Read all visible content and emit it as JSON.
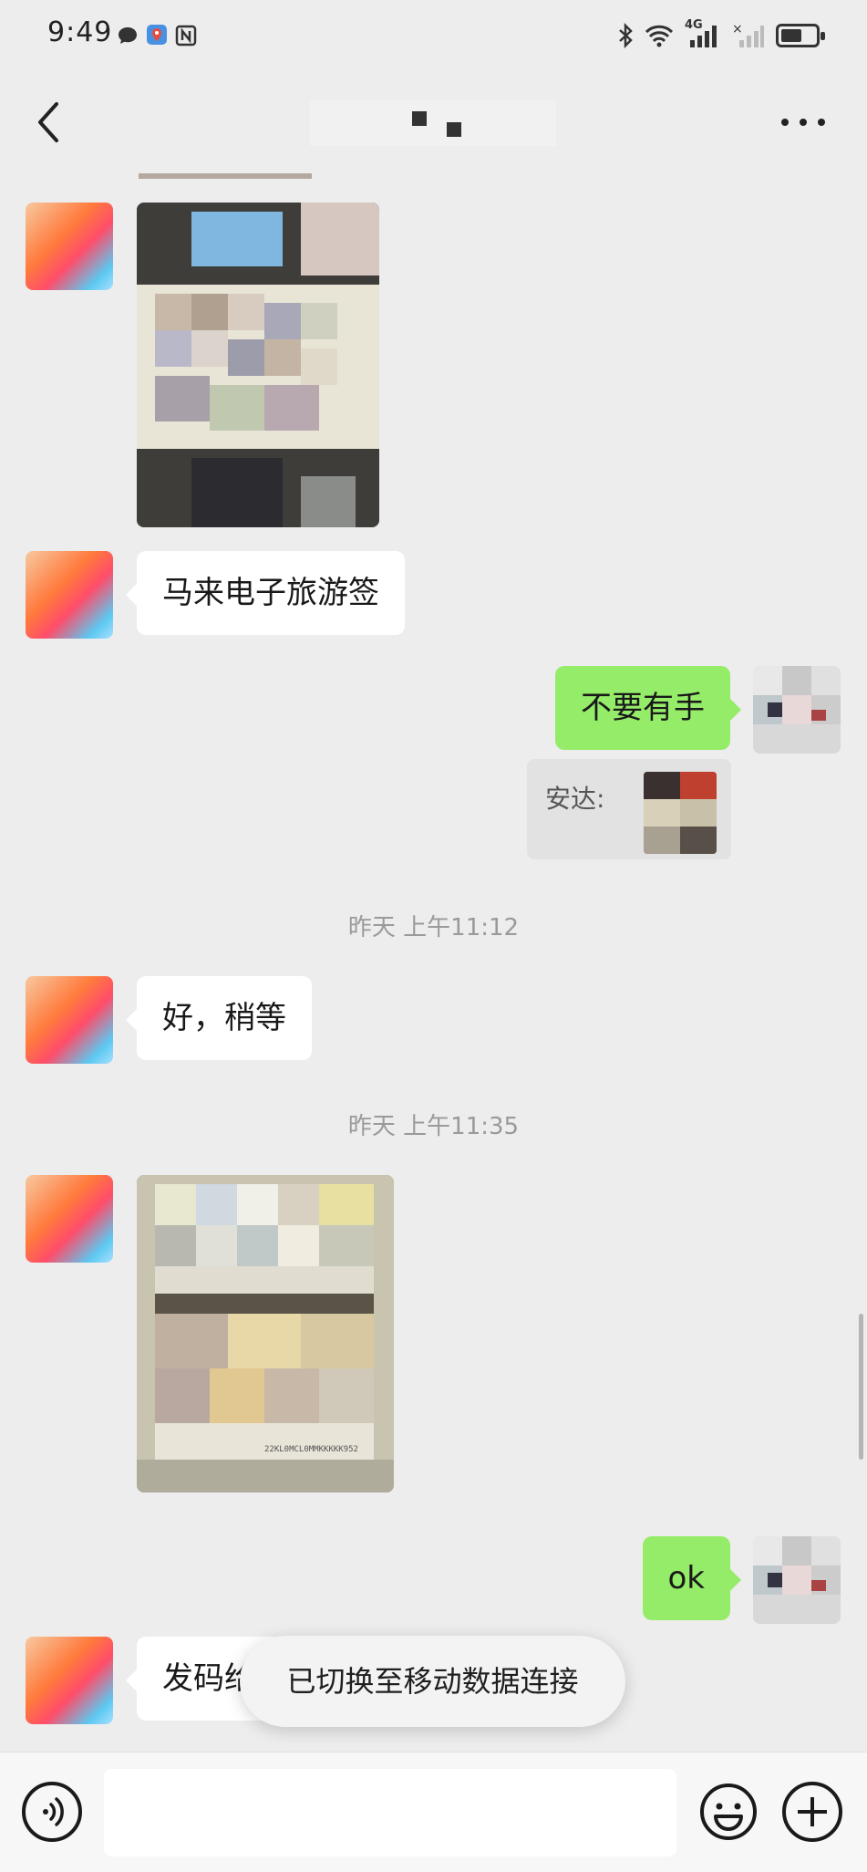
{
  "status_bar": {
    "time": "9:49",
    "network": "4G",
    "icons_left": [
      "chat-bubble-icon",
      "map-pin-icon",
      "nfc-icon"
    ],
    "icons_right": [
      "bluetooth-icon",
      "wifi-icon",
      "cellular-signal-icon",
      "no-signal-icon",
      "battery-icon"
    ],
    "battery_level": 0.6
  },
  "nav": {
    "back_icon": "chevron-left-icon",
    "more_icon": "more-horizontal-icon",
    "title_obscured": true
  },
  "messages": [
    {
      "type": "image",
      "side": "in",
      "obscured": true
    },
    {
      "type": "text",
      "side": "in",
      "text": "马来电子旅游签"
    },
    {
      "type": "text",
      "side": "out",
      "text": "不要有手"
    },
    {
      "type": "quote",
      "side": "out",
      "label": "安达:"
    },
    {
      "type": "time",
      "text": "昨天 上午11:12"
    },
    {
      "type": "text",
      "side": "in",
      "text": "好，稍等"
    },
    {
      "type": "time",
      "text": "昨天 上午11:35"
    },
    {
      "type": "image",
      "side": "in",
      "obscured": true,
      "mrz_text": "22KL0MCL0MMKKKKK952"
    },
    {
      "type": "text",
      "side": "out",
      "text": "ok"
    },
    {
      "type": "text",
      "side": "in",
      "text": "发码给"
    }
  ],
  "toast": {
    "text": "已切换至移动数据连接"
  },
  "input_bar": {
    "voice_icon": "voice-icon",
    "emoji_icon": "emoji-icon",
    "plus_icon": "plus-icon",
    "placeholder": ""
  },
  "colors": {
    "background": "#ededed",
    "bubble_out": "#95ec69",
    "bubble_in": "#ffffff"
  }
}
